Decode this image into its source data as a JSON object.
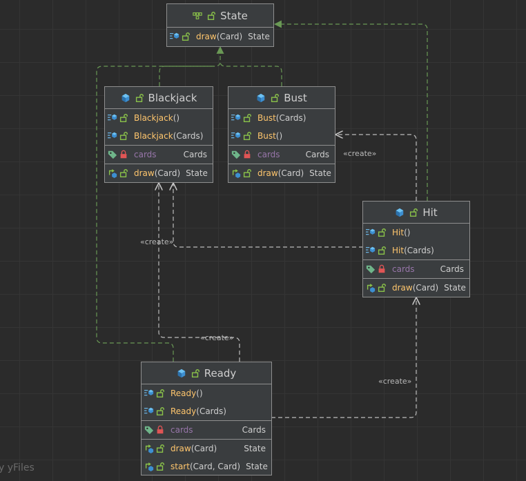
{
  "colors": {
    "background": "#2b2b2b",
    "node_fill": "#3a3d3f",
    "node_border": "#8f8f8f",
    "method_name": "#ffc66d",
    "field_name": "#9876aa",
    "realization_edge": "#6a9955",
    "dependency_edge": "#bdbdbd"
  },
  "nodes": {
    "state": {
      "title": "State",
      "icon": "interface-icon",
      "methods": [
        {
          "name": "draw",
          "params": "(Card)",
          "type": "State"
        }
      ]
    },
    "blackjack": {
      "title": "Blackjack",
      "icon": "class-icon",
      "constructors": [
        {
          "name": "Blackjack",
          "params": " ()"
        },
        {
          "name": "Blackjack",
          "params": " (Cards)"
        }
      ],
      "fields": [
        {
          "name": "cards",
          "type": "Cards"
        }
      ],
      "methods": [
        {
          "name": "draw",
          "params": "(Card)",
          "type": "State"
        }
      ]
    },
    "bust": {
      "title": "Bust",
      "icon": "class-icon",
      "constructors": [
        {
          "name": "Bust",
          "params": "(Cards)"
        },
        {
          "name": "Bust",
          "params": "()"
        }
      ],
      "fields": [
        {
          "name": "cards",
          "type": "Cards"
        }
      ],
      "methods": [
        {
          "name": "draw",
          "params": "(Card)",
          "type": "State"
        }
      ]
    },
    "hit": {
      "title": "Hit",
      "icon": "class-icon",
      "constructors": [
        {
          "name": "Hit",
          "params": "()"
        },
        {
          "name": "Hit",
          "params": "(Cards)"
        }
      ],
      "fields": [
        {
          "name": "cards",
          "type": "Cards"
        }
      ],
      "methods": [
        {
          "name": "draw",
          "params": "(Card)",
          "type": "State"
        }
      ]
    },
    "ready": {
      "title": "Ready",
      "icon": "class-icon",
      "constructors": [
        {
          "name": "Ready",
          "params": "()"
        },
        {
          "name": "Ready",
          "params": "(Cards)"
        }
      ],
      "fields": [
        {
          "name": "cards",
          "type": "Cards"
        }
      ],
      "methods": [
        {
          "name": "draw",
          "params": "(Card)",
          "type": "State"
        },
        {
          "name": "start",
          "params": "(Card, Card)",
          "type": "State"
        }
      ]
    }
  },
  "edge_labels": {
    "hit_creates_bust": "«create»",
    "hit_creates_blackjack": "«create»",
    "ready_creates_blackjack": "«create»",
    "ready_creates_hit": "«create»"
  },
  "watermark": "y yFiles"
}
